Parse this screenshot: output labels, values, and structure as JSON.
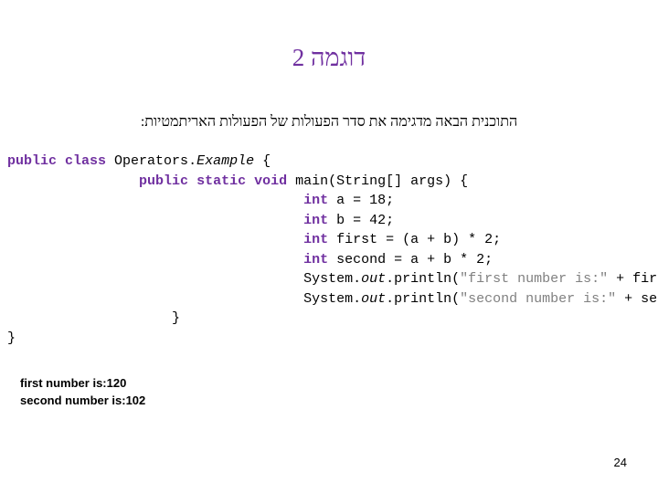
{
  "slide": {
    "title": "דוגמה 2",
    "subtitle": "התוכנית הבאה מדגימה את סדר הפעולות של הפעולות האריתמטיות:",
    "page_number": "24",
    "accent_color": "#7030a0",
    "string_color": "#808080"
  },
  "code": {
    "lines": [
      {
        "indent": 0,
        "segments": [
          {
            "t": "public",
            "s": "kw"
          },
          {
            "t": " ",
            "s": ""
          },
          {
            "t": "class",
            "s": "kw"
          },
          {
            "t": " Operators",
            "s": ""
          },
          {
            "t": ".",
            "s": ""
          },
          {
            "t": "Example",
            "s": "ital"
          },
          {
            "t": " {",
            "s": ""
          }
        ]
      },
      {
        "indent": 4,
        "segments": [
          {
            "t": "public",
            "s": "kw"
          },
          {
            "t": " ",
            "s": ""
          },
          {
            "t": "static",
            "s": "kw"
          },
          {
            "t": " ",
            "s": ""
          },
          {
            "t": "void",
            "s": "kw"
          },
          {
            "t": " main(String[] args) {",
            "s": ""
          }
        ]
      },
      {
        "indent": 9,
        "segments": [
          {
            "t": "int",
            "s": "kw"
          },
          {
            "t": " a = 18;",
            "s": ""
          }
        ]
      },
      {
        "indent": 9,
        "segments": [
          {
            "t": "int",
            "s": "kw"
          },
          {
            "t": " b = 42;",
            "s": ""
          }
        ]
      },
      {
        "indent": 9,
        "segments": [
          {
            "t": "int",
            "s": "kw"
          },
          {
            "t": " first = (a + b) * 2;",
            "s": ""
          }
        ]
      },
      {
        "indent": 9,
        "segments": [
          {
            "t": "int",
            "s": "kw"
          },
          {
            "t": " second = a + b * 2;",
            "s": ""
          }
        ]
      },
      {
        "indent": 9,
        "segments": [
          {
            "t": "System.",
            "s": ""
          },
          {
            "t": "out",
            "s": "ital"
          },
          {
            "t": ".println(",
            "s": ""
          },
          {
            "t": "\"first number is:\"",
            "s": "str"
          },
          {
            "t": " + first);",
            "s": ""
          }
        ]
      },
      {
        "indent": 9,
        "segments": [
          {
            "t": "System.",
            "s": ""
          },
          {
            "t": "out",
            "s": "ital"
          },
          {
            "t": ".println(",
            "s": ""
          },
          {
            "t": "\"second number is:\"",
            "s": "str"
          },
          {
            "t": " + second);",
            "s": ""
          }
        ]
      },
      {
        "indent": 5,
        "segments": [
          {
            "t": "}",
            "s": ""
          }
        ]
      },
      {
        "indent": 0,
        "segments": [
          {
            "t": "}",
            "s": ""
          }
        ]
      }
    ]
  },
  "output": {
    "lines": [
      "first number is:120",
      "second number is:102"
    ]
  }
}
